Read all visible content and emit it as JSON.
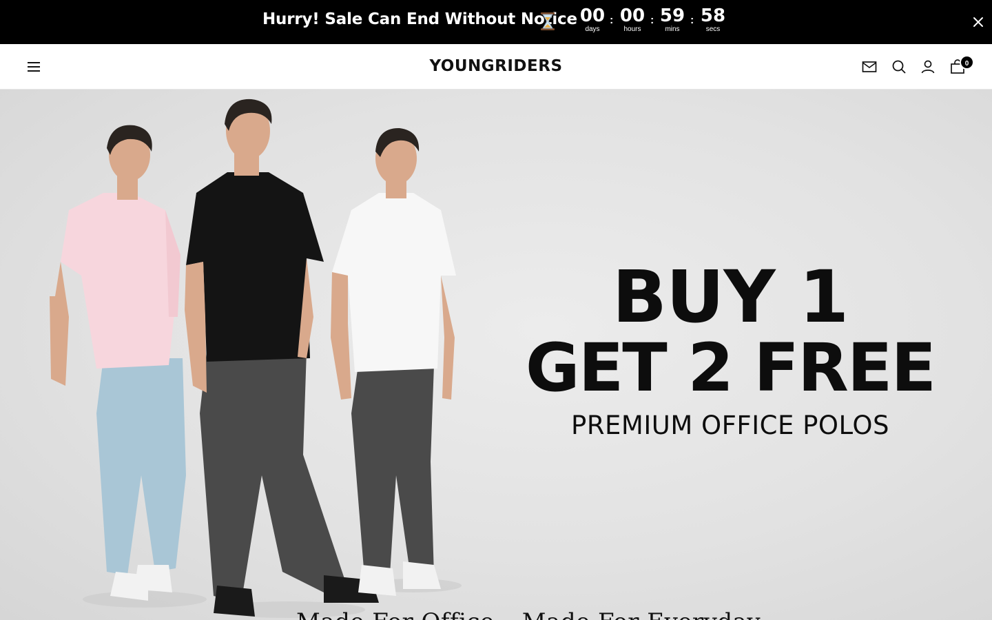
{
  "announcement": {
    "text": "Hurry! Sale Can End Without Notice",
    "emoji_icon": "hourglass-icon",
    "countdown": [
      {
        "value": "00",
        "label": "days"
      },
      {
        "value": "00",
        "label": "hours"
      },
      {
        "value": "59",
        "label": "mins"
      },
      {
        "value": "58",
        "label": "secs"
      }
    ],
    "separator": ":",
    "close_icon": "close-icon"
  },
  "header": {
    "logo": "YOUNGRIDERS",
    "menu_icon": "hamburger-menu-icon",
    "icons": [
      "mail-icon",
      "search-icon",
      "account-icon",
      "cart-icon"
    ],
    "cart_count": "0"
  },
  "hero": {
    "line1": "BUY 1",
    "line2": "GET 2 FREE",
    "line3": "PREMIUM OFFICE POLOS",
    "subline": "Made For Office – Made For Everyday",
    "image_alt": "Three models wearing pink, black and white polo shirts with jeans",
    "colors": {
      "pink_polo": "#f7d6dd",
      "black_polo": "#141414",
      "white_polo": "#f7f7f7",
      "light_jeans": "#a9c6d6",
      "dark_jeans": "#4a4a4a"
    }
  }
}
